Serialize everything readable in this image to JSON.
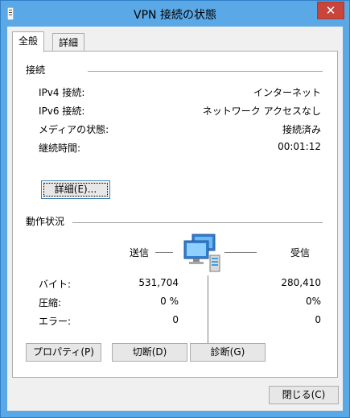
{
  "window": {
    "title": "VPN 接続の状態",
    "close_glyph": "✕"
  },
  "tabs": [
    {
      "label": "全般",
      "active": true
    },
    {
      "label": "詳細",
      "active": false
    }
  ],
  "connection": {
    "heading": "接続",
    "rows": [
      {
        "label": "IPv4 接続:",
        "value": "インターネット"
      },
      {
        "label": "IPv6 接続:",
        "value": "ネットワーク アクセスなし"
      },
      {
        "label": "メディアの状態:",
        "value": "接続済み"
      },
      {
        "label": "継続時間:",
        "value": "00:01:12"
      }
    ],
    "details_button": "詳細(E)..."
  },
  "activity": {
    "heading": "動作状況",
    "sent_label": "送信",
    "received_label": "受信",
    "rows": [
      {
        "label": "バイト:",
        "sent": "531,704",
        "received": "280,410"
      },
      {
        "label": "圧縮:",
        "sent": "0 %",
        "received": "0%"
      },
      {
        "label": "エラー:",
        "sent": "0",
        "received": "0"
      }
    ],
    "network_icon": "network-computers-icon"
  },
  "buttons": {
    "properties": "プロパティ(P)",
    "disconnect": "切断(D)",
    "diagnose": "診断(G)",
    "close": "閉じる(C)"
  },
  "colors": {
    "titlebar": "#5ba8e6",
    "close_button": "#c7453b",
    "dialog_bg": "#f0f0f0",
    "panel_bg": "#ffffff"
  }
}
